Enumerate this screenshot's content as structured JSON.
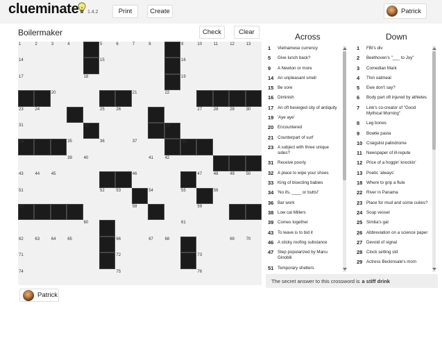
{
  "app": {
    "name": "clueminate",
    "version": "1.4.2"
  },
  "header": {
    "print_label": "Print",
    "create_label": "Create",
    "user_name": "Patrick"
  },
  "puzzle": {
    "title": "Boilermaker",
    "check_label": "Check",
    "clear_label": "Clear",
    "size": 15,
    "black_cells": [
      [
        0,
        4
      ],
      [
        0,
        9
      ],
      [
        1,
        4
      ],
      [
        1,
        9
      ],
      [
        2,
        9
      ],
      [
        3,
        0
      ],
      [
        3,
        1
      ],
      [
        3,
        5
      ],
      [
        3,
        6
      ],
      [
        3,
        11
      ],
      [
        3,
        12
      ],
      [
        3,
        13
      ],
      [
        3,
        14
      ],
      [
        4,
        3
      ],
      [
        4,
        8
      ],
      [
        5,
        4
      ],
      [
        5,
        8
      ],
      [
        5,
        9
      ],
      [
        6,
        0
      ],
      [
        6,
        1
      ],
      [
        6,
        2
      ],
      [
        6,
        9
      ],
      [
        6,
        10
      ],
      [
        6,
        11
      ],
      [
        7,
        12
      ],
      [
        7,
        13
      ],
      [
        7,
        14
      ],
      [
        8,
        5
      ],
      [
        8,
        6
      ],
      [
        8,
        10
      ],
      [
        9,
        7
      ],
      [
        9,
        11
      ],
      [
        10,
        0
      ],
      [
        10,
        1
      ],
      [
        10,
        2
      ],
      [
        10,
        3
      ],
      [
        10,
        8
      ],
      [
        10,
        13
      ],
      [
        10,
        14
      ],
      [
        11,
        5
      ],
      [
        12,
        5
      ],
      [
        12,
        10
      ],
      [
        13,
        5
      ],
      [
        13,
        10
      ]
    ],
    "numbers": [
      [
        0,
        0,
        "1"
      ],
      [
        0,
        1,
        "2"
      ],
      [
        0,
        2,
        "3"
      ],
      [
        0,
        3,
        "4"
      ],
      [
        0,
        5,
        "5"
      ],
      [
        0,
        6,
        "6"
      ],
      [
        0,
        7,
        "7"
      ],
      [
        0,
        8,
        "8"
      ],
      [
        0,
        10,
        "9"
      ],
      [
        0,
        11,
        "10"
      ],
      [
        0,
        12,
        "11"
      ],
      [
        0,
        13,
        "12"
      ],
      [
        0,
        14,
        "13"
      ],
      [
        1,
        0,
        "14"
      ],
      [
        1,
        5,
        "15"
      ],
      [
        1,
        10,
        "16"
      ],
      [
        2,
        0,
        "17"
      ],
      [
        2,
        4,
        "18"
      ],
      [
        2,
        10,
        "19"
      ],
      [
        3,
        2,
        "20"
      ],
      [
        3,
        7,
        "21"
      ],
      [
        3,
        9,
        "22"
      ],
      [
        4,
        0,
        "23"
      ],
      [
        4,
        1,
        "24"
      ],
      [
        4,
        5,
        "25"
      ],
      [
        4,
        6,
        "26"
      ],
      [
        4,
        11,
        "27"
      ],
      [
        4,
        12,
        "28"
      ],
      [
        4,
        13,
        "29"
      ],
      [
        4,
        14,
        "30"
      ],
      [
        5,
        0,
        "31"
      ],
      [
        5,
        4,
        "32"
      ],
      [
        5,
        9,
        "33"
      ],
      [
        6,
        0,
        "34"
      ],
      [
        6,
        3,
        "35"
      ],
      [
        6,
        5,
        "36"
      ],
      [
        6,
        7,
        "37"
      ],
      [
        6,
        10,
        "38"
      ],
      [
        7,
        3,
        "39"
      ],
      [
        7,
        4,
        "40"
      ],
      [
        7,
        8,
        "41"
      ],
      [
        7,
        9,
        "42"
      ],
      [
        8,
        0,
        "43"
      ],
      [
        8,
        1,
        "44"
      ],
      [
        8,
        2,
        "45"
      ],
      [
        8,
        7,
        "46"
      ],
      [
        8,
        11,
        "47"
      ],
      [
        8,
        12,
        "48"
      ],
      [
        8,
        13,
        "49"
      ],
      [
        8,
        14,
        "50"
      ],
      [
        9,
        0,
        "51"
      ],
      [
        9,
        5,
        "52"
      ],
      [
        9,
        6,
        "53"
      ],
      [
        9,
        8,
        "54"
      ],
      [
        9,
        10,
        "55"
      ],
      [
        9,
        12,
        "56"
      ],
      [
        10,
        0,
        "57"
      ],
      [
        10,
        7,
        "58"
      ],
      [
        10,
        11,
        "59"
      ],
      [
        11,
        4,
        "60"
      ],
      [
        11,
        10,
        "61"
      ],
      [
        12,
        0,
        "62"
      ],
      [
        12,
        1,
        "63"
      ],
      [
        12,
        2,
        "64"
      ],
      [
        12,
        3,
        "65"
      ],
      [
        12,
        6,
        "66"
      ],
      [
        12,
        8,
        "67"
      ],
      [
        12,
        9,
        "68"
      ],
      [
        12,
        13,
        "69"
      ],
      [
        12,
        14,
        "70"
      ],
      [
        13,
        0,
        "71"
      ],
      [
        13,
        6,
        "72"
      ],
      [
        13,
        11,
        "73"
      ],
      [
        14,
        0,
        "74"
      ],
      [
        14,
        6,
        "75"
      ],
      [
        14,
        11,
        "76"
      ]
    ]
  },
  "across_heading": "Across",
  "down_heading": "Down",
  "across": [
    {
      "n": "1",
      "text": "Vietnamese currency"
    },
    {
      "n": "5",
      "text": "Give lunch back?"
    },
    {
      "n": "9",
      "text": "A Newton or more"
    },
    {
      "n": "14",
      "text": "An unpleasant smell"
    },
    {
      "n": "15",
      "text": "Be sore"
    },
    {
      "n": "16",
      "text": "Diminish"
    },
    {
      "n": "17",
      "text": "An oft besieged city of antiquity"
    },
    {
      "n": "19",
      "text": "'Aye aye'"
    },
    {
      "n": "20",
      "text": "Encountered"
    },
    {
      "n": "21",
      "text": "Counterpart of surf"
    },
    {
      "n": "23",
      "text": "A subject with three unique sides?"
    },
    {
      "n": "31",
      "text": "Receive poorly"
    },
    {
      "n": "32",
      "text": "A place to wipe your shoes"
    },
    {
      "n": "33",
      "text": "King of bisecting babies"
    },
    {
      "n": "34",
      "text": "'No ifs, ____ or butts!'"
    },
    {
      "n": "36",
      "text": "Bar work"
    },
    {
      "n": "38",
      "text": "Low cal Millers"
    },
    {
      "n": "39",
      "text": "Comes together"
    },
    {
      "n": "43",
      "text": "To leave is to bid it"
    },
    {
      "n": "46",
      "text": "A sticky roofing substance"
    },
    {
      "n": "47",
      "text": "Step popularized by Manu Ginobili"
    },
    {
      "n": "51",
      "text": "Temporary shelters"
    },
    {
      "n": "52",
      "text": "..."
    }
  ],
  "down": [
    {
      "n": "1",
      "text": "FBI's div"
    },
    {
      "n": "2",
      "text": "Beethoven's \"___ to Joy\""
    },
    {
      "n": "3",
      "text": "Comedian Mark"
    },
    {
      "n": "4",
      "text": "Thin oatmeal"
    },
    {
      "n": "5",
      "text": "Ewe don't say?"
    },
    {
      "n": "6",
      "text": "Body part oft injured by athletes"
    },
    {
      "n": "7",
      "text": "Link's co-creator of \"Good Mythical Morning\""
    },
    {
      "n": "8",
      "text": "Leg bones"
    },
    {
      "n": "9",
      "text": "Bowtie pasta"
    },
    {
      "n": "10",
      "text": "Craigslist palindrome"
    },
    {
      "n": "11",
      "text": "Newspaper of ill-repute"
    },
    {
      "n": "12",
      "text": "Price of a hoggin' knockin'"
    },
    {
      "n": "13",
      "text": "Poetic 'always'"
    },
    {
      "n": "18",
      "text": "Where to grip a flute"
    },
    {
      "n": "22",
      "text": "River in Panama"
    },
    {
      "n": "23",
      "text": "Place for mud and some cukes?"
    },
    {
      "n": "24",
      "text": "Soup vessel"
    },
    {
      "n": "25",
      "text": "Simba's gal"
    },
    {
      "n": "26",
      "text": "Abbreviation on a science paper"
    },
    {
      "n": "27",
      "text": "Devoid of signal"
    },
    {
      "n": "28",
      "text": "Clock setting std"
    },
    {
      "n": "29",
      "text": "Actress Beckinsale's mom"
    }
  ],
  "secret": {
    "prefix": "The secret answer to this crossword is",
    "answer": "a stiff drink"
  },
  "footer": {
    "user_name": "Patrick"
  }
}
